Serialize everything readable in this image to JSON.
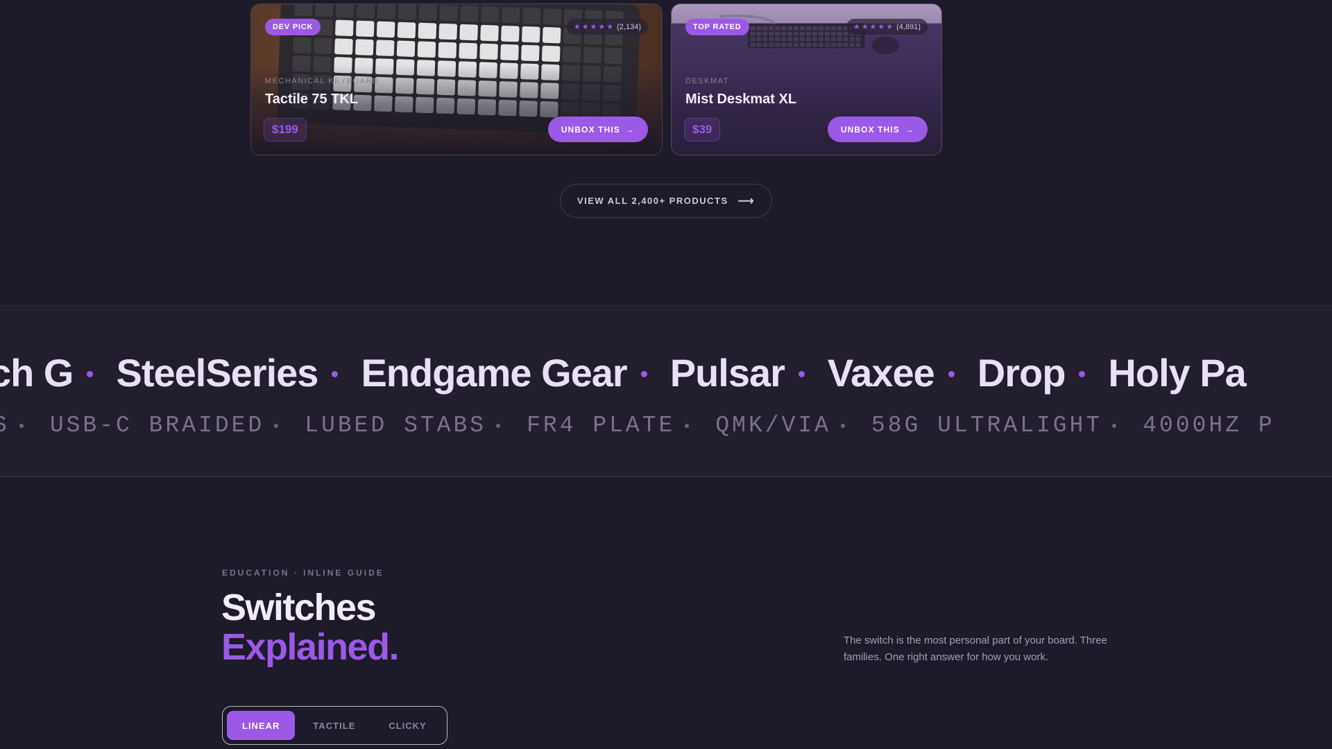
{
  "products": [
    {
      "badge": "DEV PICK",
      "rating_count": "(2,134)",
      "category": "MECHANICAL KEYBOARD",
      "title": "Tactile 75 TKL",
      "price": "$199",
      "cta": "UNBOX THIS",
      "image": "keyboard-photo"
    },
    {
      "badge": "TOP RATED",
      "rating_count": "(4,891)",
      "category": "DESKMAT",
      "title": "Mist Deskmat XL",
      "price": "$39",
      "cta": "UNBOX THIS",
      "image": "deskmat-photo"
    }
  ],
  "stars": "★★★★★",
  "cta_arrow": "→",
  "view_all": {
    "label": "VIEW ALL 2,400+ PRODUCTS",
    "arrow": "⟶"
  },
  "brands": [
    "ch G",
    "SteelSeries",
    "Endgame Gear",
    "Pulsar",
    "Vaxee",
    "Drop",
    "Holy Pa"
  ],
  "specs": [
    "S",
    "USB-C BRAIDED",
    "LUBED STABS",
    "FR4 PLATE",
    "QMK/VIA",
    "58G ULTRALIGHT",
    "4000HZ P"
  ],
  "education": {
    "eyebrow": "EDUCATION · INLINE GUIDE",
    "title_line1": "Switches",
    "title_line2": "Explained.",
    "description": "The switch is the most personal part of your board. Three families. One right answer for how you work.",
    "tabs": [
      {
        "label": "LINEAR",
        "active": true
      },
      {
        "label": "TACTILE",
        "active": false
      },
      {
        "label": "CLICKY",
        "active": false
      }
    ]
  },
  "colors": {
    "background": "#1d1a29",
    "accent": "#9b59e6",
    "band": "#221e2e"
  }
}
